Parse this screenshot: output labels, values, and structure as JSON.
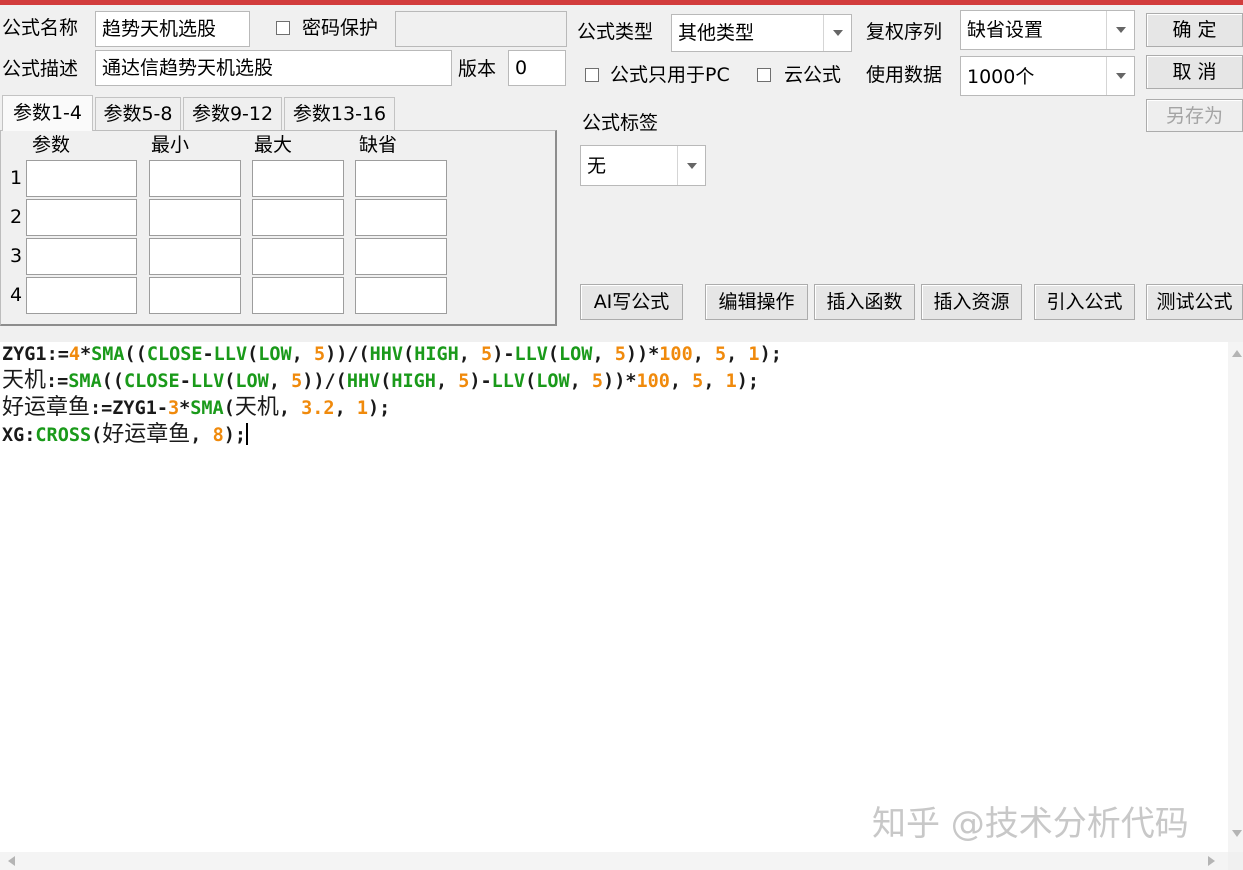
{
  "form": {
    "name_label": "公式名称",
    "name_value": "趋势天机选股",
    "password_label": "密码保护",
    "password_checked": false,
    "password_value": "",
    "desc_label": "公式描述",
    "desc_value": "通达信趋势天机选股",
    "version_label": "版本",
    "version_value": "0"
  },
  "tabs": [
    "参数1-4",
    "参数5-8",
    "参数9-12",
    "参数13-16"
  ],
  "params": {
    "headers": [
      "参数",
      "最小",
      "最大",
      "缺省"
    ],
    "rows": [
      "1",
      "2",
      "3",
      "4"
    ]
  },
  "right": {
    "type_label": "公式类型",
    "type_value": "其他类型",
    "adjust_label": "复权序列",
    "adjust_value": "缺省设置",
    "pc_only_label": "公式只用于PC",
    "cloud_label": "云公式",
    "data_label": "使用数据",
    "data_value": "1000个",
    "tag_label": "公式标签",
    "tag_value": "无"
  },
  "buttons": {
    "ok": "确 定",
    "cancel": "取 消",
    "save_as": "另存为",
    "ai": "AI写公式",
    "edit": "编辑操作",
    "insert_func": "插入函数",
    "insert_res": "插入资源",
    "import": "引入公式",
    "test": "测试公式"
  },
  "code": {
    "lines": [
      "ZYG1:=4*SMA((CLOSE-LLV(LOW, 5))/(HHV(HIGH, 5)-LLV(LOW, 5))*100, 5, 1);",
      "天机:=SMA((CLOSE-LLV(LOW, 5))/(HHV(HIGH, 5)-LLV(LOW, 5))*100, 5, 1);",
      "好运章鱼:=ZYG1-3*SMA(天机, 3.2, 1);",
      "XG:CROSS(好运章鱼, 8);"
    ],
    "colors": {
      "function": "#1a9a1a",
      "number": "#f08a0c",
      "text": "#1a1a1a"
    }
  },
  "watermark": "知乎 @技术分析代码"
}
